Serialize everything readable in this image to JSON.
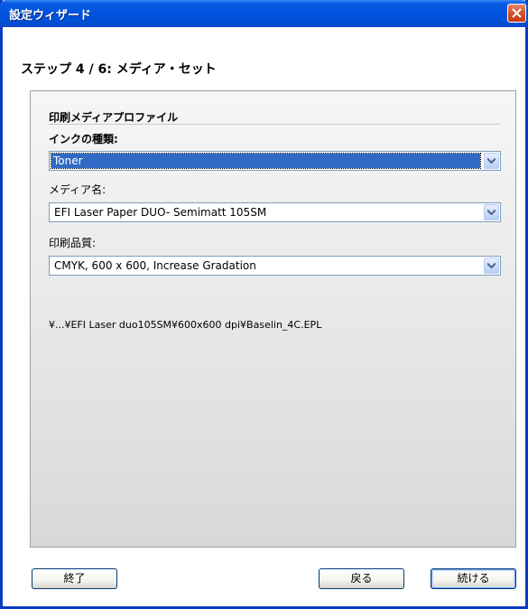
{
  "window": {
    "title": "設定ウィザード",
    "close_icon": "close-icon"
  },
  "step": {
    "title": "ステップ 4 / 6: メディア・セット"
  },
  "panel": {
    "section_title": "印刷メディアプロファイル",
    "ink_type": {
      "label": "インクの種類:",
      "value": "Toner"
    },
    "media_name": {
      "label": "メディア名:",
      "value": "EFI Laser Paper DUO- Semimatt 105SM"
    },
    "print_quality": {
      "label": "印刷品質:",
      "value": "CMYK, 600 x 600, Increase Gradation"
    },
    "profile_path": "¥...¥EFI Laser duo105SM¥600x600 dpi¥Baselin_4C.EPL"
  },
  "buttons": {
    "finish": "終了",
    "back": "戻る",
    "next": "続ける"
  },
  "colors": {
    "titlebar": "#0053e0",
    "selection": "#316ac5",
    "close": "#d4502a"
  }
}
